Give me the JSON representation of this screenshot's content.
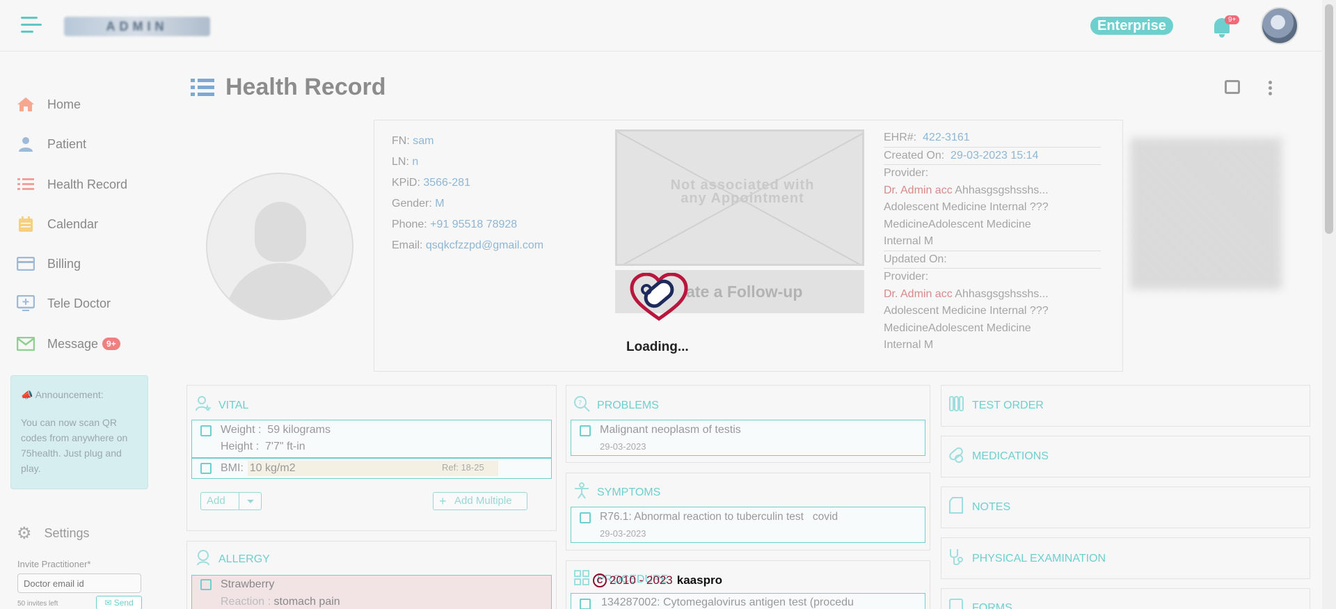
{
  "header": {
    "logo_text": "ADMIN",
    "plan_badge": "Enterprise",
    "notification_count": "9+"
  },
  "sidebar": {
    "items": [
      {
        "label": "Home",
        "icon": "home-icon",
        "color": "#f5a78f"
      },
      {
        "label": "Patient",
        "icon": "user-icon",
        "color": "#9dbbd8"
      },
      {
        "label": "Health Record",
        "icon": "list-icon",
        "color": "#f0a0a0"
      },
      {
        "label": "Calendar",
        "icon": "calendar-icon",
        "color": "#f5d080"
      },
      {
        "label": "Billing",
        "icon": "card-icon",
        "color": "#9dbbd8"
      },
      {
        "label": "Tele Doctor",
        "icon": "monitor-icon",
        "color": "#9dbbd8"
      },
      {
        "label": "Message",
        "icon": "mail-icon",
        "color": "#8fd08f",
        "badge": "9+"
      }
    ],
    "announcement": {
      "title": "Announcement:",
      "body": "You can now scan QR codes from anywhere on 75health. Just plug and play."
    },
    "settings_label": "Settings",
    "invite": {
      "label": "Invite Practitioner*",
      "placeholder": "Doctor email id",
      "invites_left": "50 invites left",
      "send_label": "Send"
    }
  },
  "page": {
    "title": "Health Record"
  },
  "patient": {
    "fn_label": "FN:",
    "fn": "sam",
    "ln_label": "LN:",
    "ln": "n",
    "kpid_label": "KPiD:",
    "kpid": "3566-281",
    "gender_label": "Gender:",
    "gender": "M",
    "phone_label": "Phone:",
    "phone": "+91 95518 78928",
    "email_label": "Email:",
    "email": "qsqkcfzzpd@gmail.com"
  },
  "appointment": {
    "placeholder_text": "Not associated with any Appointment",
    "followup_label": "ate a Follow-up",
    "loading_text": "Loading..."
  },
  "record_meta": {
    "ehr_label": "EHR#:",
    "ehr": "422-3161",
    "created_label": "Created On:",
    "created": "29-03-2023 15:14",
    "provider_label": "Provider:",
    "created_provider_name": "Dr. Admin acc",
    "created_provider_rest": "Ahhasgsgshsshs...",
    "created_provider_line2": "Adolescent Medicine Internal ???",
    "created_provider_line3": "MedicineAdolescent Medicine",
    "created_provider_line4": "Internal M",
    "updated_label": "Updated On:",
    "updated_provider_label": "Provider:",
    "updated_provider_name": "Dr. Admin acc",
    "updated_provider_rest": "Ahhasgsgshsshs...",
    "updated_provider_line2": "Adolescent Medicine Internal ???",
    "updated_provider_line3": "MedicineAdolescent Medicine",
    "updated_provider_line4": "Internal M"
  },
  "vital": {
    "title": "VITAL",
    "weight_label": "Weight :",
    "weight": "59 kilograms",
    "height_label": "Height :",
    "height": "7'7\" ft-in",
    "bmi_label": "BMI:",
    "bmi": "10 kg/m2",
    "bmi_ref": "Ref: 18-25",
    "add_label": "Add",
    "add_multiple_label": "Add Multiple"
  },
  "allergy": {
    "title": "ALLERGY",
    "name": "Strawberry",
    "reaction_label": "Reaction :",
    "reaction": "stomach pain"
  },
  "problems": {
    "title": "PROBLEMS",
    "item": "Malignant neoplasm of testis",
    "date": "29-03-2023"
  },
  "symptoms": {
    "title": "SYMPTOMS",
    "item": "R76.1: Abnormal reaction to tuberculin test",
    "note": "covid",
    "date": "29-03-2023"
  },
  "procedure": {
    "title": "PROCEDURE",
    "item": "134287002: Cytomegalovirus antigen test (procedu"
  },
  "right_panels": [
    {
      "title": "TEST ORDER",
      "icon": "flask-icon"
    },
    {
      "title": "MEDICATIONS",
      "icon": "pills-icon"
    },
    {
      "title": "NOTES",
      "icon": "note-icon"
    },
    {
      "title": "PHYSICAL EXAMINATION",
      "icon": "stethoscope-icon"
    },
    {
      "title": "FORMS",
      "icon": "form-icon"
    }
  ],
  "footer": {
    "copyright": "2010 - 2023",
    "brand": "kaaspro"
  }
}
